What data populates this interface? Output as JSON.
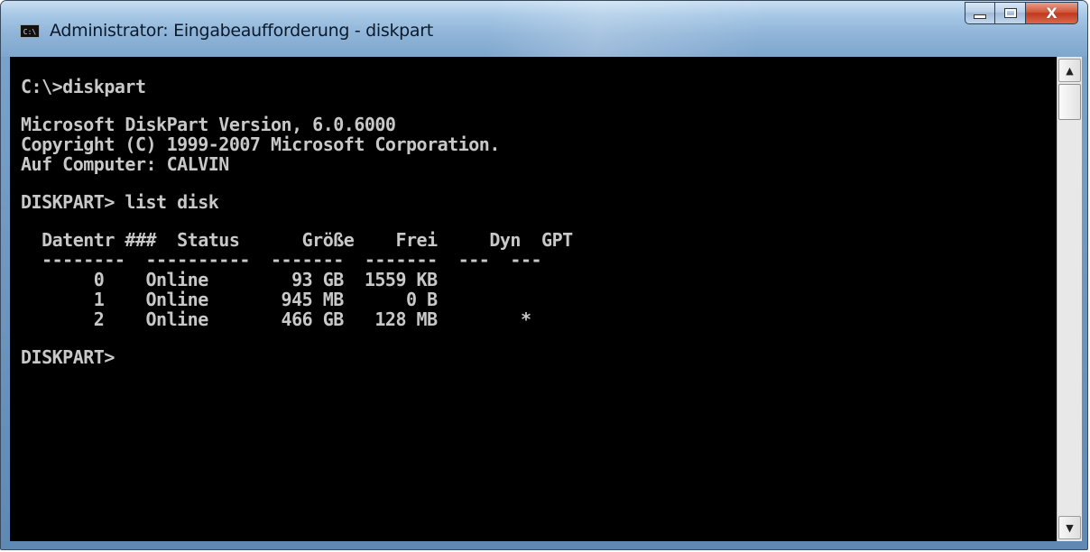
{
  "window": {
    "title": "Administrator: Eingabeaufforderung - diskpart",
    "icon_label": "C:\\"
  },
  "caption_buttons": {
    "minimize": "minimize-icon",
    "maximize": "maximize-icon",
    "close": "close-icon",
    "close_glyph": "X"
  },
  "console": {
    "lines": [
      "C:\\>diskpart",
      "",
      "Microsoft DiskPart Version, 6.0.6000",
      "Copyright (C) 1999-2007 Microsoft Corporation.",
      "Auf Computer: CALVIN",
      "",
      "DISKPART> list disk",
      "",
      "  Datentr ###  Status      Größe    Frei     Dyn  GPT",
      "  --------  ----------  -------  -------  ---  ---",
      "       0    Online        93 GB  1559 KB",
      "       1    Online       945 MB      0 B",
      "       2    Online       466 GB   128 MB        *",
      "",
      "DISKPART>"
    ],
    "text_color": "#c8c8c8",
    "background_color": "#000000"
  },
  "scrollbar": {
    "up_arrow": "▲",
    "down_arrow": "▼"
  }
}
